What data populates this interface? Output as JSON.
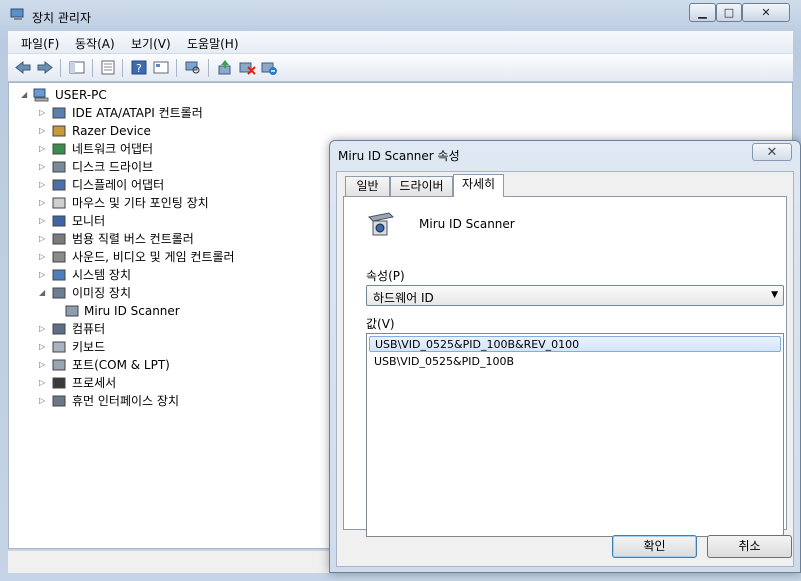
{
  "window": {
    "title": "장치 관리자",
    "caption_buttons": [
      "minimize",
      "maximize",
      "close"
    ]
  },
  "menu": [
    "파일(F)",
    "동작(A)",
    "보기(V)",
    "도움말(H)"
  ],
  "toolbar_icons": [
    "back-icon",
    "forward-icon",
    "show-hide-tree-icon",
    "properties-icon",
    "help-icon",
    "view-icon",
    "scan-hardware-icon",
    "update-driver-icon",
    "disable-icon",
    "uninstall-icon"
  ],
  "tree": {
    "root": "USER-PC",
    "items": [
      {
        "label": "IDE ATA/ATAPI 컨트롤러",
        "icon": "ide-icon"
      },
      {
        "label": "Razer Device",
        "icon": "razer-icon"
      },
      {
        "label": "네트워크 어댑터",
        "icon": "network-icon"
      },
      {
        "label": "디스크 드라이브",
        "icon": "disk-icon"
      },
      {
        "label": "디스플레이 어댑터",
        "icon": "display-icon"
      },
      {
        "label": "마우스 및 기타 포인팅 장치",
        "icon": "mouse-icon"
      },
      {
        "label": "모니터",
        "icon": "monitor-icon"
      },
      {
        "label": "범용 직렬 버스 컨트롤러",
        "icon": "usb-icon"
      },
      {
        "label": "사운드, 비디오 및 게임 컨트롤러",
        "icon": "sound-icon"
      },
      {
        "label": "시스템 장치",
        "icon": "system-icon"
      },
      {
        "label": "이미징 장치",
        "icon": "imaging-icon",
        "expanded": true
      },
      {
        "label": "Miru ID Scanner",
        "icon": "scanner-icon",
        "child": true
      },
      {
        "label": "컴퓨터",
        "icon": "computer-icon"
      },
      {
        "label": "키보드",
        "icon": "keyboard-icon"
      },
      {
        "label": "포트(COM & LPT)",
        "icon": "port-icon"
      },
      {
        "label": "프로세서",
        "icon": "processor-icon"
      },
      {
        "label": "휴먼 인터페이스 장치",
        "icon": "hid-icon"
      }
    ]
  },
  "dialog": {
    "title": "Miru ID Scanner 속성",
    "tabs": [
      {
        "label": "일반",
        "active": false
      },
      {
        "label": "드라이버",
        "active": false
      },
      {
        "label": "자세히",
        "active": true
      }
    ],
    "device_name": "Miru ID Scanner",
    "property_label": "속성(P)",
    "property_value": "하드웨어 ID",
    "value_label": "값(V)",
    "values": [
      {
        "text": "USB\\VID_0525&PID_100B&REV_0100",
        "selected": true
      },
      {
        "text": "USB\\VID_0525&PID_100B",
        "selected": false
      }
    ],
    "ok_label": "확인",
    "cancel_label": "취소"
  }
}
